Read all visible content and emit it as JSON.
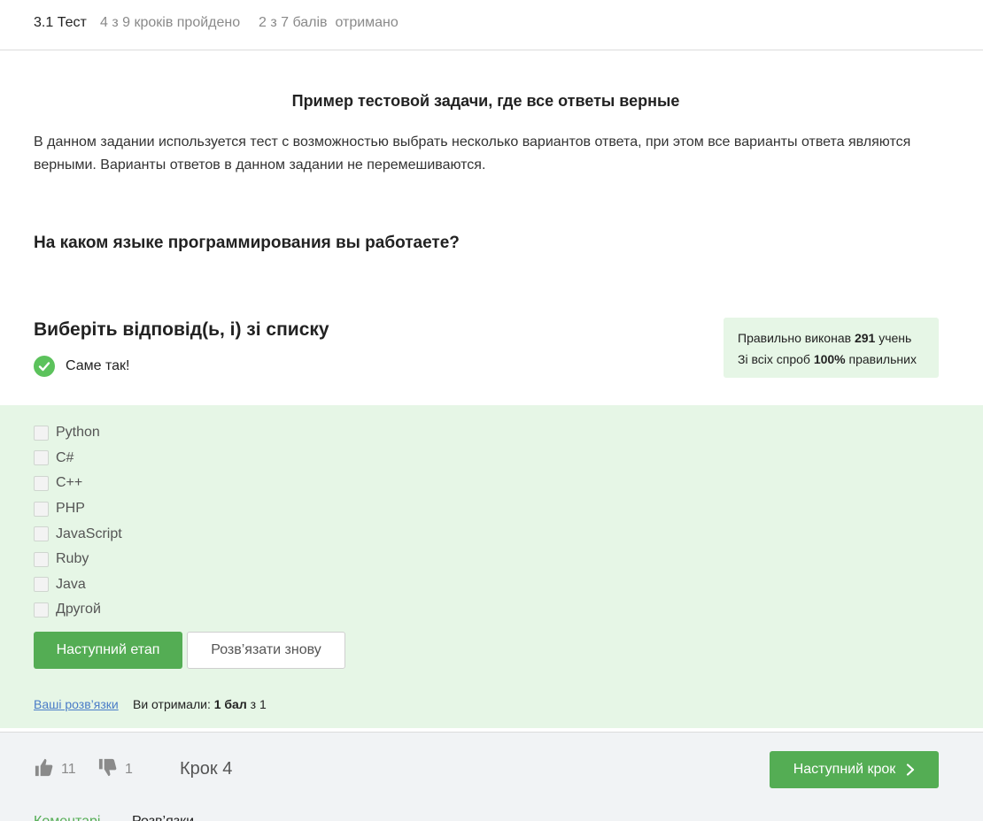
{
  "header": {
    "lesson": "3.1 Тест",
    "steps_progress": "4 з 9 кроків пройдено",
    "points_progress": "2 з 7 балів  отримано"
  },
  "task": {
    "title": "Пример тестовой задачи, где все ответы верные",
    "description": "В данном задании используется тест с возможностью выбрать несколько вариантов ответа, при этом все варианты ответа являются верными. Варианты ответов в данном задании не перемешиваются.",
    "question": "На каком языке программирования вы работаете?"
  },
  "quiz": {
    "prompt": "Виберіть відповід(ь, і) зі списку",
    "result_text": "Саме так!",
    "stats": {
      "line1_prefix": "Правильно виконав",
      "line1_count": "291",
      "line1_suffix": "учень",
      "line2_prefix": "Зі всіх спроб",
      "line2_percent": "100%",
      "line2_suffix": "правильних"
    },
    "options": [
      {
        "label": "Python",
        "checked": false
      },
      {
        "label": "C#",
        "checked": false
      },
      {
        "label": "C++",
        "checked": false
      },
      {
        "label": "PHP",
        "checked": false
      },
      {
        "label": "JavaScript",
        "checked": false
      },
      {
        "label": "Ruby",
        "checked": false
      },
      {
        "label": "Java",
        "checked": false
      },
      {
        "label": "Другой",
        "checked": false
      }
    ],
    "next_stage_label": "Наступний етап",
    "retry_label": "Розв’язати знову",
    "solutions_link": "Ваші розв’язки",
    "score_prefix": "Ви отримали:",
    "score_value": "1 бал",
    "score_suffix": "з 1"
  },
  "footer": {
    "likes": "11",
    "dislikes": "1",
    "step_label": "Крок 4",
    "next_step_label": "Наступний крок",
    "tabs": [
      "Коментарі",
      "Розв’язки"
    ]
  },
  "colors": {
    "accent": "#54ad54",
    "success_bg": "#e6f6e6",
    "link": "#4a7cc7"
  },
  "icons": {
    "result": "check-circle-icon",
    "like": "thumbs-up-icon",
    "dislike": "thumbs-down-icon",
    "next_step": "chevron-right-icon"
  }
}
